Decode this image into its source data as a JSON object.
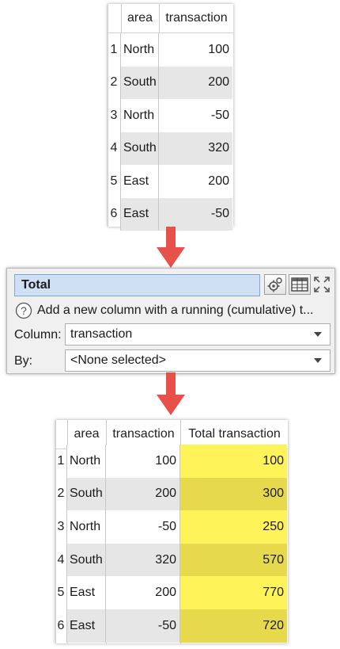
{
  "input_table": {
    "headers": [
      "area",
      "transaction"
    ],
    "rows": [
      {
        "n": "1",
        "area": "North",
        "transaction": "100"
      },
      {
        "n": "2",
        "area": "South",
        "transaction": "200"
      },
      {
        "n": "3",
        "area": "North",
        "transaction": "-50"
      },
      {
        "n": "4",
        "area": "South",
        "transaction": "320"
      },
      {
        "n": "5",
        "area": "East",
        "transaction": "200"
      },
      {
        "n": "6",
        "area": "East",
        "transaction": "-50"
      }
    ]
  },
  "panel": {
    "title": "Total",
    "help_text": "Add a new column with a running (cumulative) t...",
    "column_label": "Column:",
    "column_value": "transaction",
    "by_label": "By:",
    "by_value": "<None selected>"
  },
  "output_table": {
    "headers": [
      "area",
      "transaction",
      "Total transaction"
    ],
    "rows": [
      {
        "n": "1",
        "area": "North",
        "transaction": "100",
        "total": "100"
      },
      {
        "n": "2",
        "area": "South",
        "transaction": "200",
        "total": "300"
      },
      {
        "n": "3",
        "area": "North",
        "transaction": "-50",
        "total": "250"
      },
      {
        "n": "4",
        "area": "South",
        "transaction": "320",
        "total": "570"
      },
      {
        "n": "5",
        "area": "East",
        "transaction": "200",
        "total": "770"
      },
      {
        "n": "6",
        "area": "East",
        "transaction": "-50",
        "total": "720"
      }
    ]
  },
  "colors": {
    "arrow": "#e8504a",
    "highlight_light": "#fff35a",
    "highlight_dark": "#e6da4c",
    "row_alt": "#e6e6e6",
    "title_bg": "#cfe0f5"
  },
  "icons": [
    "settings-gears-icon",
    "table-view-icon",
    "maximize-icon",
    "help-icon",
    "dropdown-caret-icon",
    "down-arrow-icon"
  ]
}
